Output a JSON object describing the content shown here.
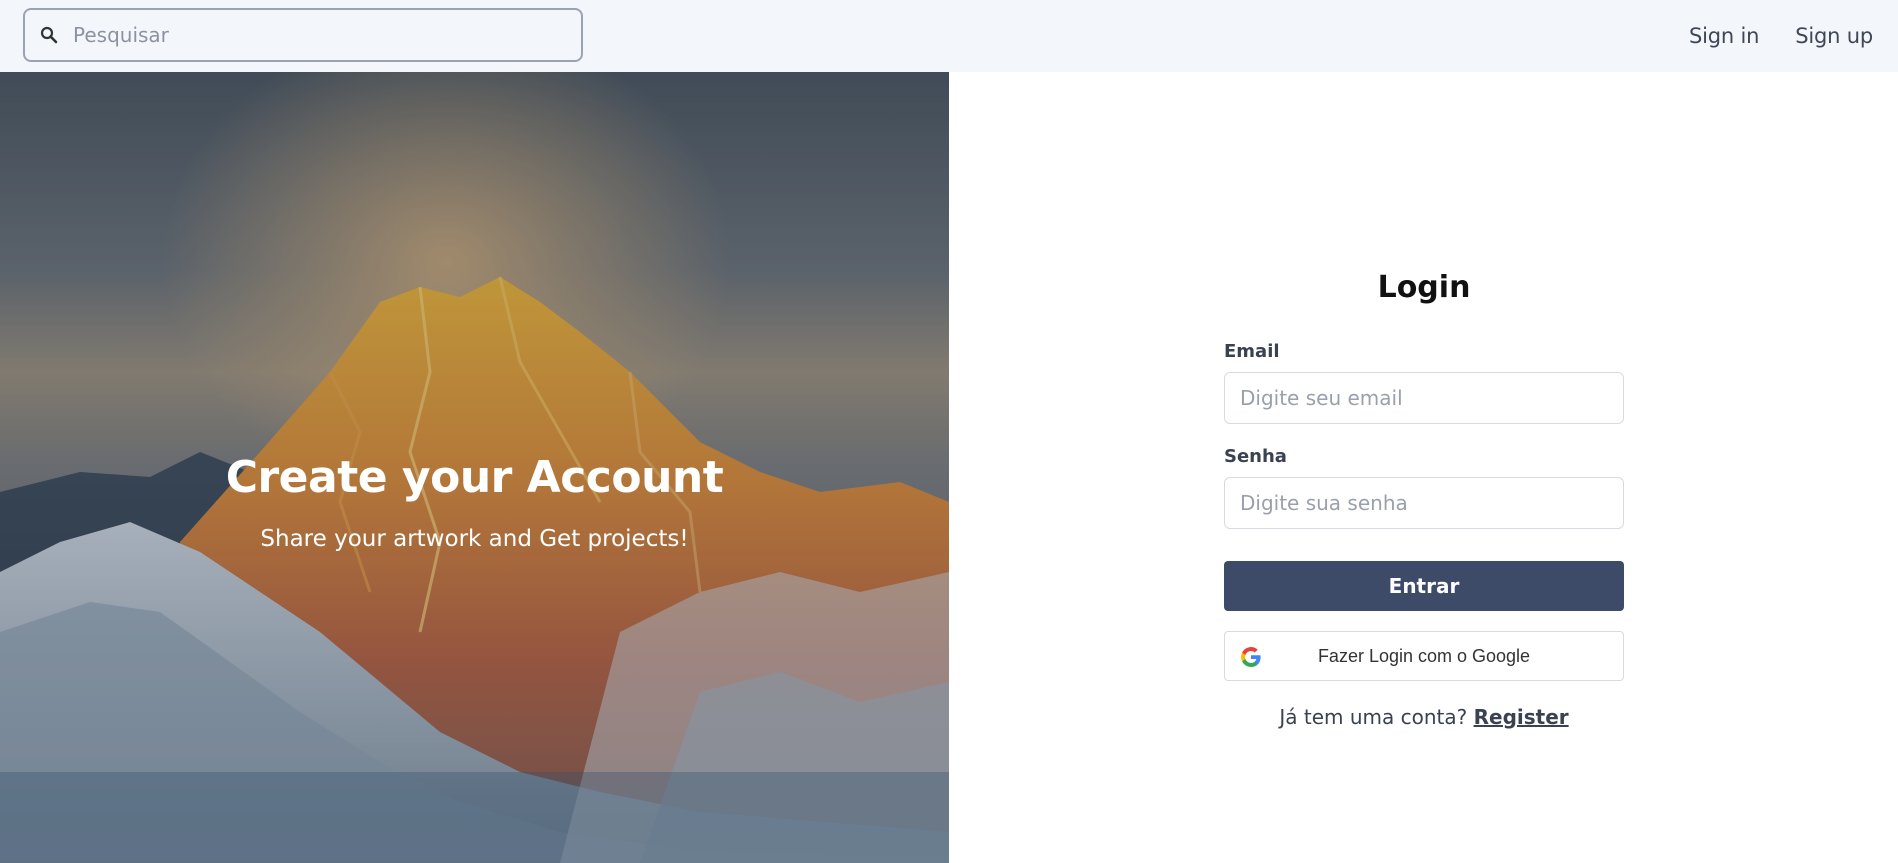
{
  "header": {
    "search_placeholder": "Pesquisar",
    "sign_in": "Sign in",
    "sign_up": "Sign up"
  },
  "hero": {
    "title": "Create your Account",
    "subtitle": "Share your artwork and Get projects!"
  },
  "login": {
    "title": "Login",
    "email_label": "Email",
    "email_placeholder": "Digite seu email",
    "password_label": "Senha",
    "password_placeholder": "Digite sua senha",
    "submit_label": "Entrar",
    "google_label": "Fazer Login com o Google",
    "register_prompt": "Já tem uma conta?",
    "register_link": "Register"
  },
  "icons": {
    "search": "search-icon",
    "google": "google-icon"
  },
  "colors": {
    "primary_button": "#3e4b68",
    "topbar_bg": "#f3f6fb"
  }
}
